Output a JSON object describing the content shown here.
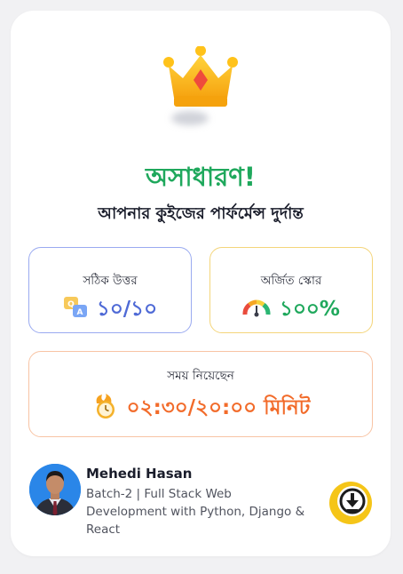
{
  "result": {
    "title": "অসাধারণ!",
    "subtitle": "আপনার কুইজের পার্ফর্মেন্স দুর্দান্ত"
  },
  "stats": {
    "correct": {
      "label": "সঠিক উত্তর",
      "value": "১০/১০",
      "icon": "quiz-qa-icon"
    },
    "score": {
      "label": "অর্জিত স্কোর",
      "value": "১০০%",
      "icon": "gauge-icon"
    },
    "time": {
      "label": "সময় নিয়েছেন",
      "value": "০২:৩০/২০:০০ মিনিট",
      "icon": "stopwatch-icon"
    }
  },
  "user": {
    "name": "Mehedi Hasan",
    "batch": "Batch-2 | Full Stack Web Development with Python, Django & React"
  },
  "colors": {
    "title_green": "#1fa85c",
    "correct_blue": "#4f6ad6",
    "score_green": "#1fa85c",
    "time_orange": "#f26b2a",
    "download_yellow": "#f5c518"
  }
}
